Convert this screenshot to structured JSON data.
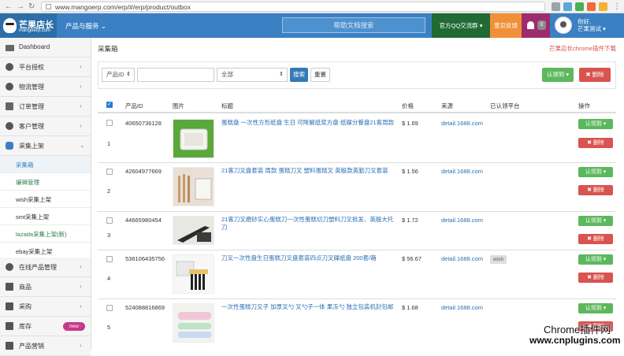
{
  "browser": {
    "url": "www.mangoerp.com/erp/#/erp/product/outbox"
  },
  "header": {
    "logo_name": "芒果店长",
    "logo_domain": "mangoerp.com",
    "products_menu": "产品与服务 ⌄",
    "help_search_placeholder": "帮助文档搜索",
    "qq_group": "官方QQ交流群 ▾",
    "feedback": "意见反馈",
    "notification_count": "0",
    "greeting": "你好,",
    "username": "芒果测试 ▾"
  },
  "sidebar": {
    "items": [
      {
        "label": "Dashboard"
      },
      {
        "label": "平台授权",
        "chevron": "›"
      },
      {
        "label": "物流管理",
        "chevron": "›"
      },
      {
        "label": "订单管理",
        "chevron": "›"
      },
      {
        "label": "客户管理",
        "chevron": "›"
      },
      {
        "label": "采集上架",
        "chevron": "⌄"
      }
    ],
    "sub_items": [
      {
        "label": "采集箱"
      },
      {
        "label": "编辑管理"
      },
      {
        "label": "wish采集上架"
      },
      {
        "label": "smt采集上架"
      },
      {
        "label": "lazada采集上架(新)"
      },
      {
        "label": "ebay采集上架"
      }
    ],
    "lower_items": [
      {
        "label": "在线产品管理",
        "chevron": "›"
      },
      {
        "label": "商品",
        "chevron": "›"
      },
      {
        "label": "采购",
        "chevron": "›"
      },
      {
        "label": "库存",
        "chevron": "›",
        "badge": "new"
      },
      {
        "label": "产品营销",
        "chevron": "›"
      }
    ]
  },
  "main": {
    "page_title": "采集箱",
    "plugin_link": "芒果店长chrome插件下载",
    "filter_field": "产品ID",
    "filter_scope": "全部",
    "search_button": "搜索",
    "reset_button": "重置",
    "claim_button": "认领到 ▾",
    "delete_button": "✖ 删除"
  },
  "table": {
    "headers": {
      "product_id": "产品ID",
      "image": "图片",
      "title": "标题",
      "price": "价格",
      "source": "来源",
      "claimed_platforms": "已认领平台",
      "actions": "操作"
    },
    "rows": [
      {
        "num": "1",
        "product_id": "40650736128",
        "title": "蛋糕盘 一次性方形纸盘 生日 可降解纸浆方盘 纸碟分餐盘21客周款",
        "price": "$ 1.69",
        "source": "detail.1688.com",
        "platforms": ""
      },
      {
        "num": "2",
        "product_id": "42604977669",
        "title": "21客刀叉盘套装 周款 蛋糕刀叉 塑料蛋糕叉 英殷款英勤刀叉套装",
        "price": "$ 1.56",
        "source": "detail.1688.com",
        "platforms": ""
      },
      {
        "num": "3",
        "product_id": "44665980454",
        "title": "21客刀叉磨砂实心蛋糕刀一次性蛋糕切刀塑料刀叉批发、英殷大托刀",
        "price": "$ 1.72",
        "source": "detail.1688.com",
        "platforms": ""
      },
      {
        "num": "4",
        "product_id": "536106435756",
        "title": "刀叉一次性盘生日蛋糕刀叉盘套装四点刀叉碟纸盘 200套/箱",
        "price": "$ 56.67",
        "source": "detail.1688.com",
        "platforms": "wish"
      },
      {
        "num": "5",
        "product_id": "524088816869",
        "title": "一次性蛋糕刀叉子 加厚叉勺 叉勺子一体 果冻勺 独立包装机封包邮",
        "price": "$ 1.68",
        "source": "detail.1688.com",
        "platforms": ""
      }
    ],
    "row_claim_label": "认领到 ▾",
    "row_delete_label": "✖ 删除"
  },
  "watermark": {
    "line1": "Chrome插件网",
    "line2": "www.cnplugins.com"
  }
}
